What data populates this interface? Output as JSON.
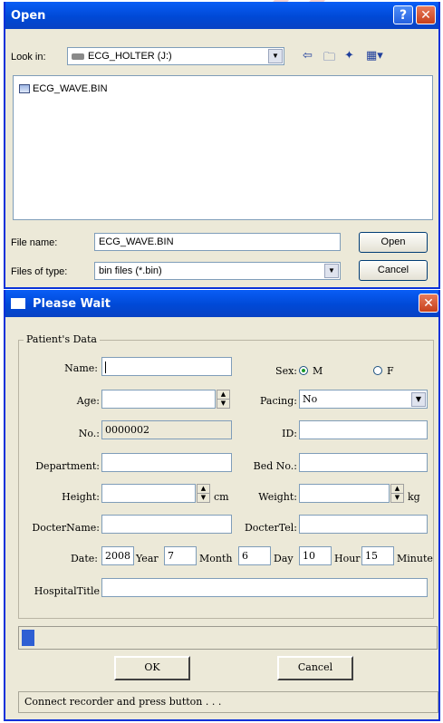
{
  "open_dialog": {
    "title": "Open",
    "look_in_label": "Look in:",
    "look_in_value": "ECG_HOLTER (J:)",
    "files": [
      {
        "name": "ECG_WAVE.BIN"
      }
    ],
    "file_name_label": "File name:",
    "file_name_value": "ECG_WAVE.BIN",
    "files_of_type_label": "Files of type:",
    "files_of_type_value": "bin files (*.bin)",
    "open_button": "Open",
    "cancel_button": "Cancel"
  },
  "wait_dialog": {
    "title": "Please Wait",
    "group_title": "Patient's Data",
    "name_label": "Name:",
    "name_value": "",
    "sex_label": "Sex:",
    "sex_options": [
      "M",
      "F"
    ],
    "sex_selected": "M",
    "age_label": "Age:",
    "age_value": "",
    "pacing_label": "Pacing:",
    "pacing_value": "No",
    "no_label": "No.:",
    "no_value": "0000002",
    "id_label": "ID:",
    "id_value": "",
    "department_label": "Department:",
    "department_value": "",
    "bed_no_label": "Bed No.:",
    "bed_no_value": "",
    "height_label": "Height:",
    "height_value": "",
    "height_unit": "cm",
    "weight_label": "Weight:",
    "weight_value": "",
    "weight_unit": "kg",
    "docter_name_label": "DocterName:",
    "docter_name_value": "",
    "docter_tel_label": "DocterTel:",
    "docter_tel_value": "",
    "date_label": "Date:",
    "year_value": "2008",
    "year_label": "Year",
    "month_value": "7",
    "month_label": "Month",
    "day_value": "6",
    "day_label": "Day",
    "hour_value": "10",
    "hour_label": "Hour",
    "minute_value": "15",
    "minute_label": "Minute",
    "hospital_title_label": "HospitalTitle",
    "hospital_title_value": "",
    "progress_fraction": 0.03,
    "ok_button": "OK",
    "cancel_button": "Cancel",
    "status_text": "Connect recorder and press button . . ."
  },
  "colors": {
    "titlebar": "#0054e3",
    "dialog_bg": "#ece9d8",
    "progress": "#2e5fd3",
    "close": "#d4461e"
  },
  "icons": [
    "help-icon",
    "close-icon",
    "drive-icon",
    "back-icon",
    "up-folder-icon",
    "new-folder-icon",
    "view-menu-icon",
    "file-icon",
    "dropdown-arrow-icon",
    "spin-up-icon",
    "spin-down-icon"
  ]
}
